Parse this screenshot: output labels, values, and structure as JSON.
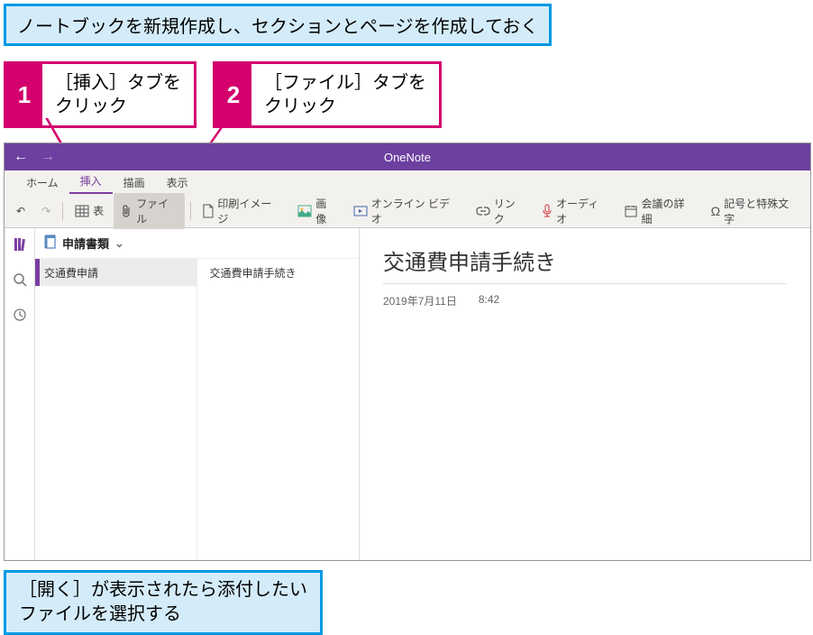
{
  "callouts": {
    "top": "ノートブックを新規作成し、セクションとページを作成しておく",
    "bottom_line1": "［開く］が表示されたら添付したい",
    "bottom_line2": "ファイルを選択する"
  },
  "steps": [
    {
      "num": "1",
      "line1": "［挿入］タブを",
      "line2": "クリック"
    },
    {
      "num": "2",
      "line1": "［ファイル］タブを",
      "line2": "クリック"
    }
  ],
  "app": {
    "title": "OneNote",
    "tabs": [
      {
        "label": "ホーム",
        "active": false
      },
      {
        "label": "挿入",
        "active": true
      },
      {
        "label": "描画",
        "active": false
      },
      {
        "label": "表示",
        "active": false
      }
    ],
    "toolbar": {
      "undo": "↶",
      "redo": "↷",
      "table": "表",
      "file": "ファイル",
      "printout": "印刷イメージ",
      "picture": "画像",
      "online_video": "オンライン ビデオ",
      "link": "リンク",
      "audio": "オーディオ",
      "meeting": "会議の詳細",
      "symbol": "記号と特殊文字"
    },
    "notebook": {
      "name": "申請書類",
      "dropdown_marker": "⌄"
    },
    "section": {
      "name": "交通費申請"
    },
    "page": {
      "list_label": "交通費申請手続き",
      "title": "交通費申請手続き",
      "date": "2019年7月11日",
      "time": "8:42"
    }
  }
}
